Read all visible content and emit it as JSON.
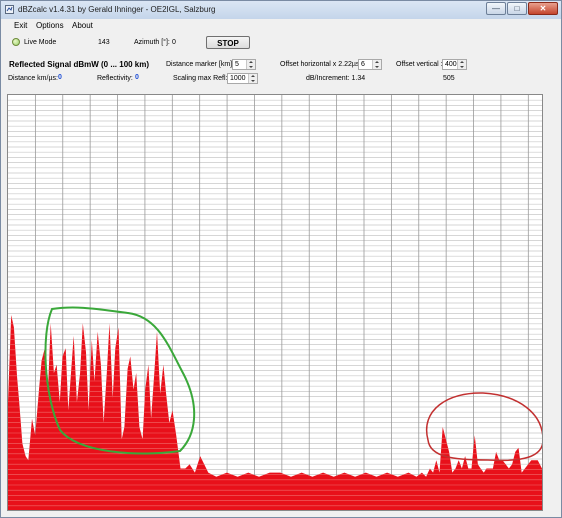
{
  "window": {
    "title": "dBZcalc v1.4.31 by Gerald Ihninger - OE2IGL, Salzburg",
    "minimize_icon": "minimize-icon",
    "maximize_icon": "maximize-icon",
    "close_icon": "close-icon"
  },
  "menu": [
    "Exit",
    "Options",
    "About"
  ],
  "status": {
    "mode_label": "Live Mode",
    "count": "143",
    "azimuth_label": "Azimuth [°]:",
    "azimuth_value": "0",
    "stop_label": "STOP"
  },
  "controls": {
    "section_title": "Reflected Signal dBmW (0 ... 100 km)",
    "distance_marker_label": "Distance marker [km]:",
    "distance_marker_value": "5",
    "offset_h_label": "Offset horizontal x 2.22µs :",
    "offset_h_value": "6",
    "offset_v_label": "Offset vertical :",
    "offset_v_value": "400",
    "distance_label": "Distance km/µs:",
    "distance_value": "0",
    "reflectivity_label": "Reflectivity:",
    "reflectivity_value": "0",
    "scaling_label": "Scaling max Refl:",
    "scaling_value": "1000",
    "db_increment_label": "dB/Increment: 1.34",
    "right_value": "505"
  },
  "colors": {
    "fill": "#e8101a",
    "grid": "#c8c8c8",
    "green_annotation": "#3aa83a",
    "red_annotation": "#c23030"
  },
  "chart_data": {
    "type": "area",
    "title": "",
    "xlabel": "",
    "ylabel": "",
    "xlim": [
      0,
      100
    ],
    "ylim": [
      0,
      100
    ],
    "grid": true,
    "series": [
      {
        "x": [
          0,
          0.6,
          1.1,
          1.7,
          2.1,
          2.7,
          3.3,
          3.8,
          4.5,
          5.1,
          5.8,
          6.3,
          6.9,
          7.5,
          8.0,
          8.6,
          9.1,
          9.7,
          10.2,
          10.8,
          11.3,
          11.8,
          12.3,
          12.9,
          13.5,
          14.0,
          14.6,
          15.1,
          15.7,
          16.2,
          16.8,
          17.4,
          17.9,
          18.5,
          19.0,
          19.6,
          20.1,
          20.7,
          21.3,
          21.8,
          22.4,
          22.9,
          23.5,
          24.0,
          24.6,
          25.2,
          25.7,
          26.3,
          26.8,
          27.4,
          27.9,
          28.5,
          29.1,
          29.6,
          30.2,
          30.8,
          31.5,
          32.3,
          33.2,
          34.0,
          35.0,
          36.0,
          37.5,
          39.0,
          41.0,
          43.0,
          45.0,
          47.0,
          49.0,
          51.0,
          53.0,
          55.0,
          57.0,
          59.0,
          61.0,
          63.0,
          65.0,
          67.0,
          69.0,
          71.0,
          73.0,
          75.0,
          76.5,
          77.5,
          78.3,
          79.0,
          79.6,
          80.2,
          80.8,
          81.4,
          82.0,
          82.6,
          83.2,
          83.8,
          84.4,
          85.0,
          85.6,
          86.2,
          86.8,
          87.4,
          88.0,
          88.5,
          89.1,
          89.6,
          90.2,
          90.8,
          91.4,
          92.0,
          92.6,
          93.2,
          93.8,
          94.4,
          95.0,
          95.6,
          96.2,
          96.8,
          97.4,
          98.0,
          98.6,
          99.2,
          100
        ],
        "y": [
          26,
          47,
          44,
          32,
          26,
          16,
          13,
          12,
          22,
          18,
          29,
          36,
          39,
          29,
          45,
          33,
          35,
          26,
          37,
          39,
          24,
          33,
          42,
          26,
          33,
          45,
          38,
          24,
          41,
          31,
          43,
          35,
          21,
          33,
          45,
          27,
          39,
          44,
          17,
          20,
          34,
          37,
          29,
          33,
          20,
          17,
          29,
          35,
          22,
          33,
          43,
          28,
          35,
          28,
          21,
          24,
          18,
          10,
          10,
          11,
          9,
          13,
          9,
          8,
          9,
          8,
          9,
          8,
          9,
          9,
          8,
          9,
          8,
          9,
          8,
          9,
          8,
          9,
          8,
          9,
          8,
          9,
          8,
          9,
          8,
          10,
          9,
          12,
          9,
          20,
          17,
          14,
          9,
          10,
          12,
          10,
          13,
          10,
          10,
          18,
          11,
          10,
          9,
          10,
          10,
          10,
          14,
          12,
          12,
          11,
          10,
          11,
          14,
          15,
          9,
          10,
          11,
          12,
          12,
          12,
          10
        ]
      }
    ]
  }
}
